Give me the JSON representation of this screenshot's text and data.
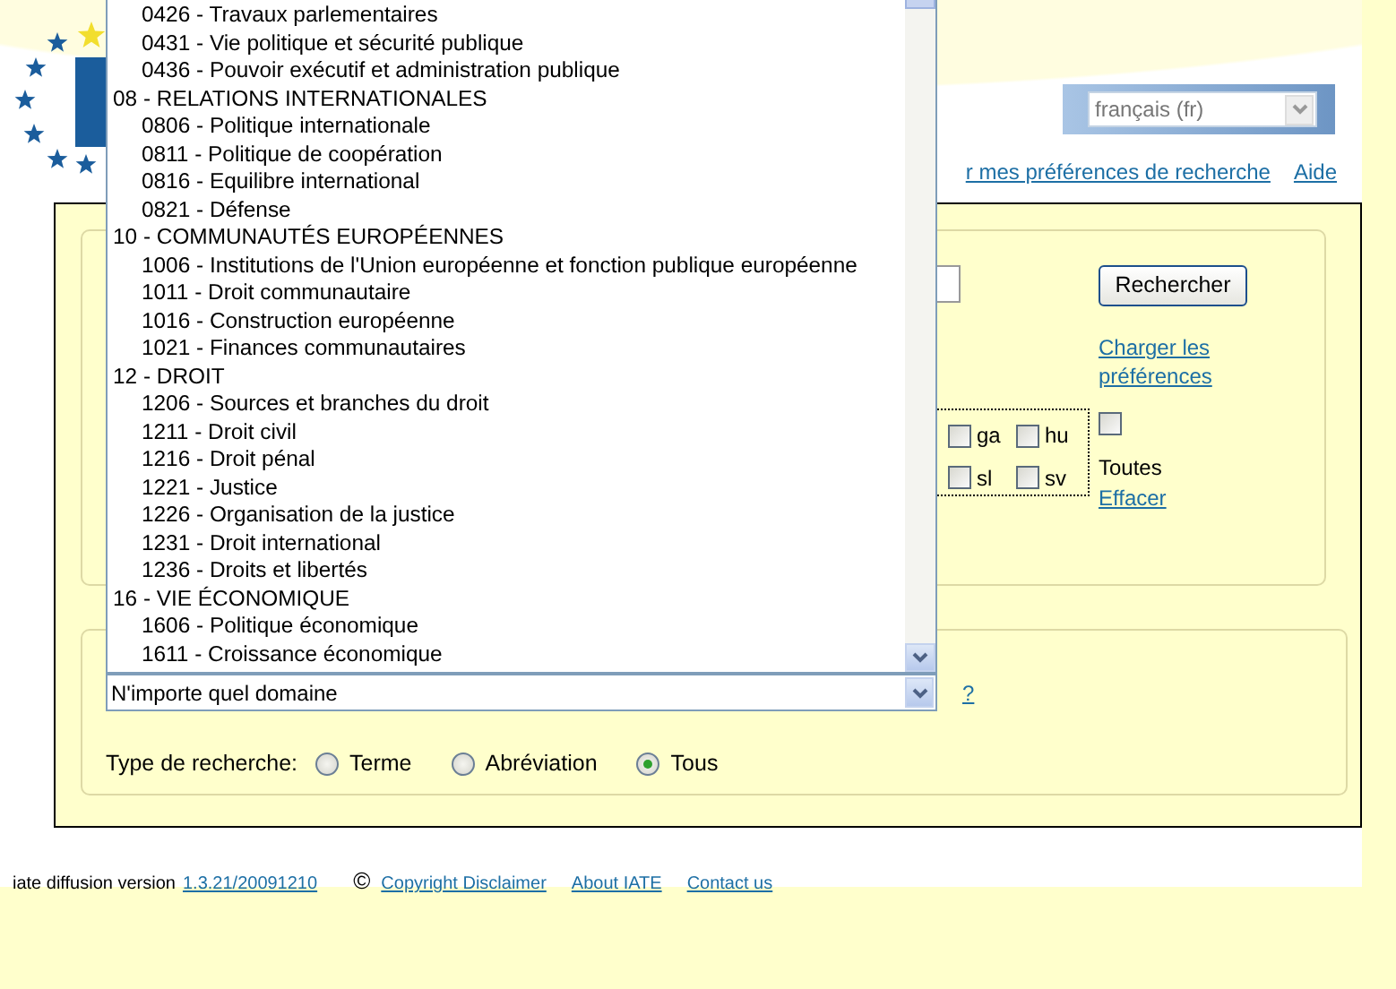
{
  "header": {
    "language_select": {
      "value": "français (fr)"
    },
    "links": [
      "r mes préférences de recherche",
      "Aide"
    ]
  },
  "search_panel": {
    "search_button": "Rechercher",
    "load_preferences_link": "Charger les préférences",
    "languages": [
      {
        "code": "ga",
        "checked": false
      },
      {
        "code": "hu",
        "checked": false
      },
      {
        "code": "sl",
        "checked": false
      },
      {
        "code": "sv",
        "checked": false
      }
    ],
    "all_languages": {
      "label": "Toutes",
      "checked": false
    },
    "clear_link": "Effacer"
  },
  "domain_panel": {
    "domain_select": {
      "value": "N'importe quel domaine",
      "expanded": true
    },
    "help_link": "?",
    "search_type": {
      "label": "Type de recherche:",
      "options": [
        {
          "label": "Terme",
          "selected": false
        },
        {
          "label": "Abréviation",
          "selected": false
        },
        {
          "label": "Tous",
          "selected": true
        }
      ]
    }
  },
  "domain_list": [
    {
      "children": [
        {
          "label": "0426 - Travaux parlementaires"
        },
        {
          "label": "0431 - Vie politique et sécurité publique"
        },
        {
          "label": "0436 - Pouvoir exécutif et administration publique"
        }
      ]
    },
    {
      "label": "08 - RELATIONS INTERNATIONALES",
      "children": [
        {
          "label": "0806 - Politique internationale"
        },
        {
          "label": "0811 - Politique de coopération"
        },
        {
          "label": "0816 - Equilibre international"
        },
        {
          "label": "0821 - Défense"
        }
      ]
    },
    {
      "label": "10 - COMMUNAUTÉS EUROPÉENNES",
      "children": [
        {
          "label": "1006 - Institutions de l'Union européenne et fonction publique européenne"
        },
        {
          "label": "1011 - Droit communautaire"
        },
        {
          "label": "1016 - Construction européenne"
        },
        {
          "label": "1021 - Finances communautaires"
        }
      ]
    },
    {
      "label": "12 - DROIT",
      "children": [
        {
          "label": "1206 - Sources et branches du droit"
        },
        {
          "label": "1211 - Droit civil"
        },
        {
          "label": "1216 - Droit pénal"
        },
        {
          "label": "1221 - Justice"
        },
        {
          "label": "1226 - Organisation de la justice"
        },
        {
          "label": "1231 - Droit international"
        },
        {
          "label": "1236 - Droits et libertés"
        }
      ]
    },
    {
      "label": "16 - VIE ÉCONOMIQUE",
      "children": [
        {
          "label": "1606 - Politique économique"
        },
        {
          "label": "1611 - Croissance économique"
        }
      ]
    }
  ],
  "footer": {
    "version_label": "iate diffusion version",
    "version": "1.3.21/20091210",
    "copyright_symbol": "©",
    "links": [
      "Copyright Disclaimer",
      "About IATE",
      "Contact us"
    ]
  }
}
